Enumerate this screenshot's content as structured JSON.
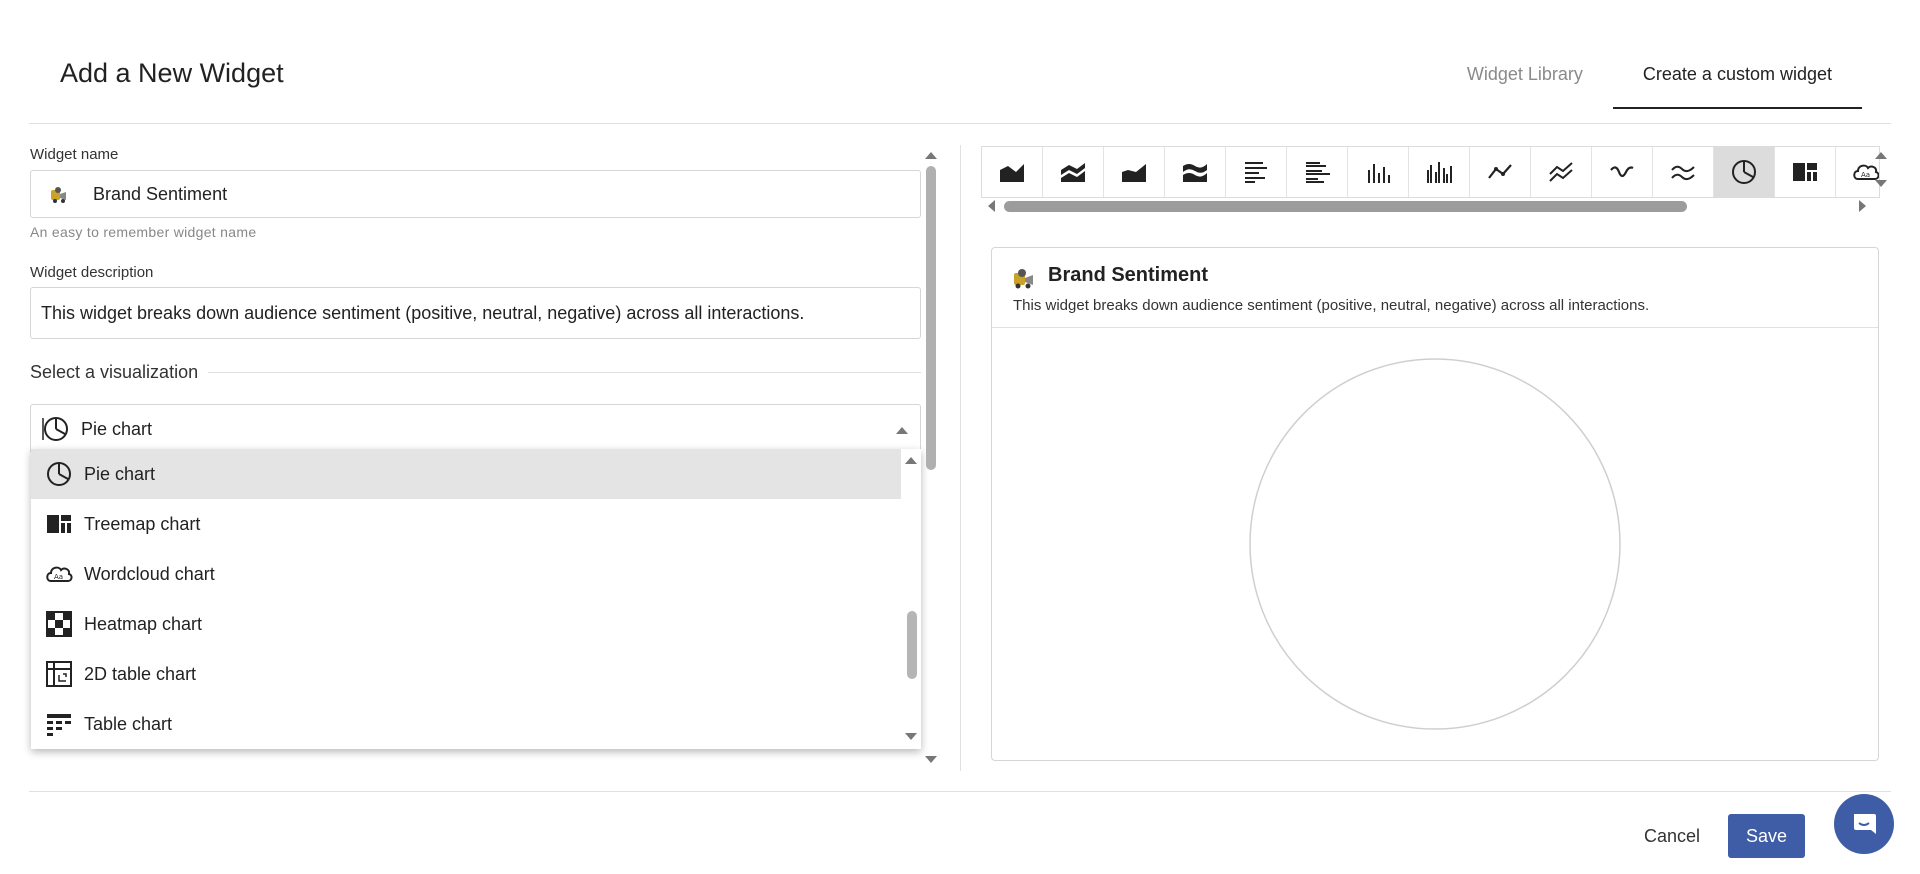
{
  "modal": {
    "title": "Add a New Widget",
    "tabs": [
      {
        "label": "Widget Library",
        "active": false
      },
      {
        "label": "Create a custom widget",
        "active": true
      }
    ]
  },
  "form": {
    "name_label": "Widget name",
    "name_value": "Brand Sentiment",
    "name_hint": "An easy to remember widget name",
    "description_label": "Widget description",
    "description_value": "This widget breaks down audience sentiment (positive, neutral, negative) across all interactions.",
    "visualization_section": "Select a visualization",
    "visualization_selected": "Pie chart"
  },
  "dropdown": {
    "options": [
      {
        "label": "Pie chart",
        "icon": "pie-chart-icon",
        "selected": true
      },
      {
        "label": "Treemap chart",
        "icon": "treemap-icon",
        "selected": false
      },
      {
        "label": "Wordcloud chart",
        "icon": "wordcloud-icon",
        "selected": false
      },
      {
        "label": "Heatmap chart",
        "icon": "heatmap-icon",
        "selected": false
      },
      {
        "label": "2D table chart",
        "icon": "2d-table-icon",
        "selected": false
      },
      {
        "label": "Table chart",
        "icon": "table-chart-icon",
        "selected": false
      }
    ]
  },
  "viz_strip": {
    "icons": [
      "area-chart-icon",
      "stacked-area-icon",
      "stepped-area-icon",
      "stream-area-icon",
      "horizontal-bar-icon",
      "grouped-horizontal-bar-icon",
      "vertical-bar-icon",
      "grouped-vertical-bar-icon",
      "line-chart-icon",
      "multi-line-icon",
      "spline-icon",
      "multi-spline-icon",
      "pie-chart-icon",
      "treemap-icon",
      "wordcloud-icon"
    ],
    "active": "pie-chart-icon"
  },
  "preview": {
    "title": "Brand Sentiment",
    "description": "This widget breaks down audience sentiment (positive, neutral, negative) across all interactions."
  },
  "footer": {
    "cancel_label": "Cancel",
    "save_label": "Save"
  },
  "colors": {
    "primary": "#3e5da6",
    "selected_row": "#e4e4e4"
  }
}
